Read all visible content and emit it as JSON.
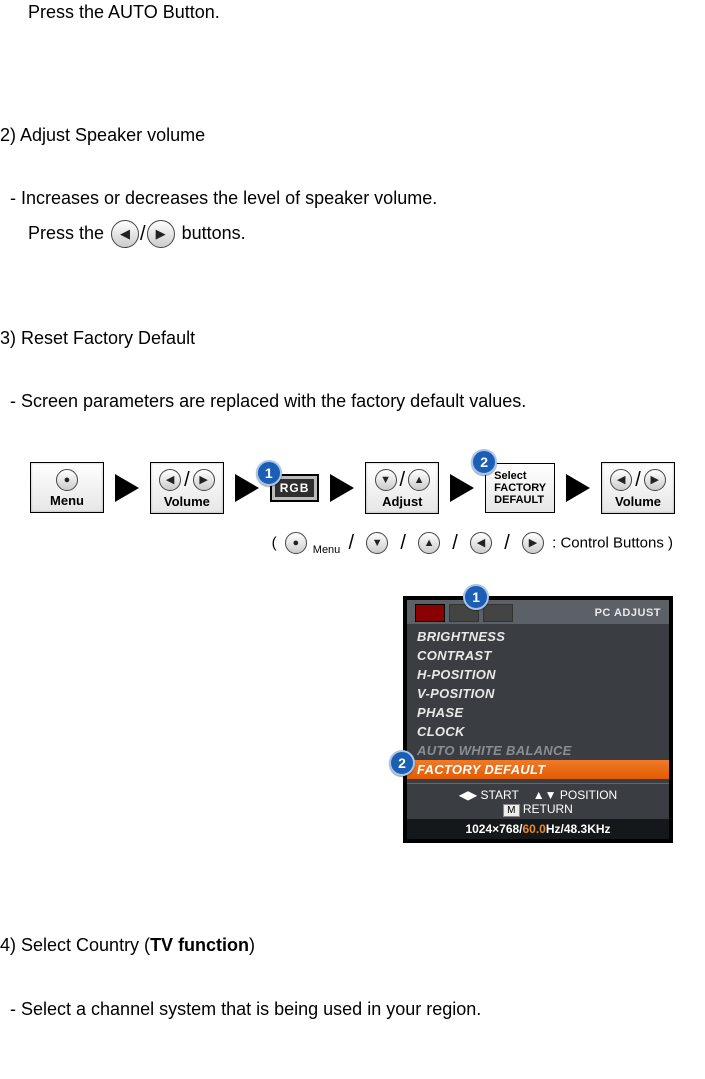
{
  "s1": {
    "instruction": "Press the AUTO Button."
  },
  "s2": {
    "heading": "2) Adjust Speaker volume",
    "desc": "- Increases or decreases the level of speaker volume.",
    "press_pre": "Press the ",
    "press_post": "buttons."
  },
  "s3": {
    "heading": "3) Reset Factory Default",
    "desc": "- Screen parameters are replaced with the factory default values."
  },
  "flow": {
    "menu_label": "Menu",
    "volume_label": "Volume",
    "rgb_label": "RGB",
    "adjust_label": "Adjust",
    "select_line1": "Select",
    "select_line2": "FACTORY",
    "select_line3": "DEFAULT",
    "caption_prefix": "( ",
    "caption_menu": "Menu",
    "caption_suffix": " : Control Buttons )"
  },
  "osd": {
    "title": "PC  ADJUST",
    "items": [
      {
        "label": "BRIGHTNESS",
        "selected": false,
        "dim": false
      },
      {
        "label": "CONTRAST",
        "selected": false,
        "dim": false
      },
      {
        "label": "H-POSITION",
        "selected": false,
        "dim": false
      },
      {
        "label": "V-POSITION",
        "selected": false,
        "dim": false
      },
      {
        "label": "PHASE",
        "selected": false,
        "dim": false
      },
      {
        "label": "CLOCK",
        "selected": false,
        "dim": false
      },
      {
        "label": "AUTO WHITE BALANCE",
        "selected": false,
        "dim": true
      },
      {
        "label": "FACTORY DEFAULT",
        "selected": true,
        "dim": false
      }
    ],
    "hint_start": "◀▶ START",
    "hint_position": "▲▼ POSITION",
    "hint_return_pre": "",
    "hint_return_m": "M",
    "hint_return_post": " RETURN",
    "status_pre": "1024×768/",
    "status_hz": "60.0",
    "status_post": "Hz/48.3KHz"
  },
  "s4": {
    "heading_pre": "4) Select Country (",
    "heading_bold": "TV function",
    "heading_post": ")",
    "desc": "- Select a channel system that is being used in your region."
  }
}
